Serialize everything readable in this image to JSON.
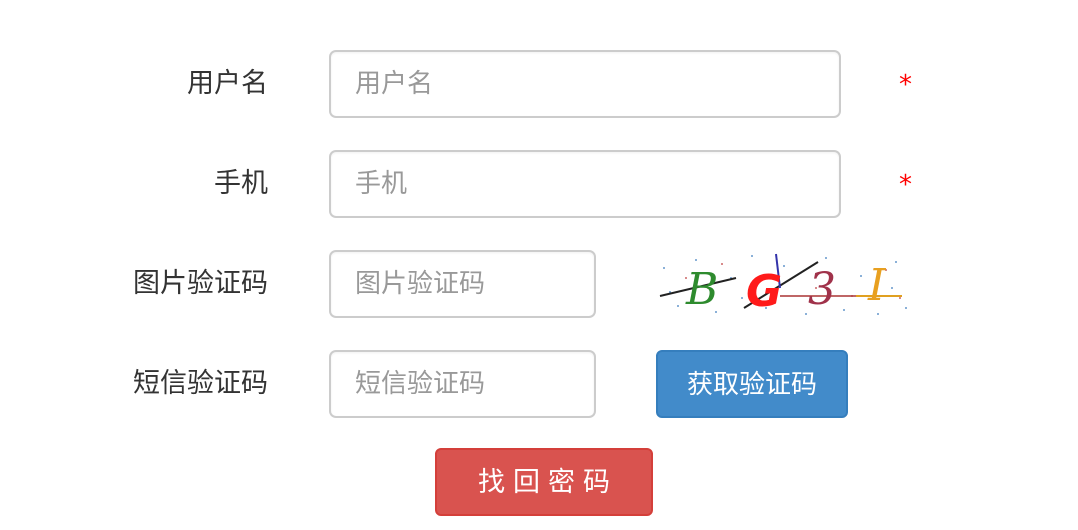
{
  "form": {
    "username": {
      "label": "用户名",
      "placeholder": "用户名",
      "value": "",
      "required_mark": "*"
    },
    "phone": {
      "label": "手机",
      "placeholder": "手机",
      "value": "",
      "required_mark": "*"
    },
    "image_captcha": {
      "label": "图片验证码",
      "placeholder": "图片验证码",
      "value": "",
      "captcha_text": "BG3I"
    },
    "sms_code": {
      "label": "短信验证码",
      "placeholder": "短信验证码",
      "value": "",
      "get_code_label": "获取验证码"
    },
    "submit_label": "找回密码"
  },
  "colors": {
    "required": "#ff0000",
    "primary_button": "#428bca",
    "danger_button": "#d9534f",
    "input_border": "#cccccc"
  }
}
